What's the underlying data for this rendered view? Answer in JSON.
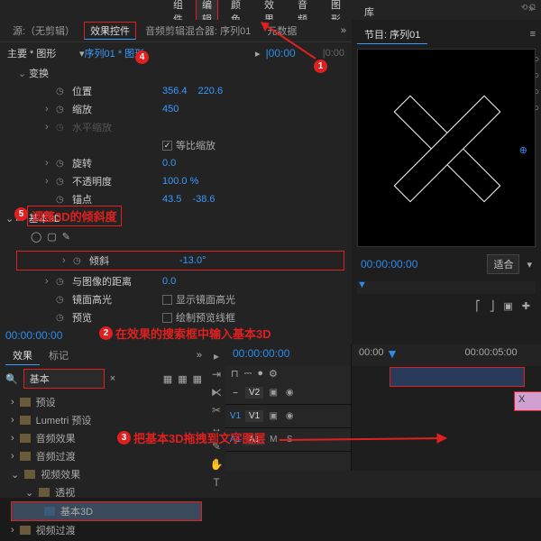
{
  "top_tabs": [
    "组件",
    "编辑",
    "颜色",
    "效果",
    "音频",
    "图形",
    "库"
  ],
  "active_top": 1,
  "source_label": "源:（无剪辑）",
  "panel_tabs": {
    "effect_controls": "效果控件",
    "audio_mixer": "音频剪辑混合器: 序列01",
    "metadata": "元数据"
  },
  "main_label": "主要 * 图形",
  "clip_label": "序列01 * 图形",
  "groups": {
    "transform": "变换",
    "rows": [
      {
        "n": "位置",
        "v": [
          "356.4",
          "220.6"
        ]
      },
      {
        "n": "缩放",
        "v": [
          "450"
        ]
      },
      {
        "n": "水平缩放",
        "dim": true
      },
      {
        "n": "等比缩放",
        "check": true
      },
      {
        "n": "旋转",
        "v": [
          "0.0"
        ]
      },
      {
        "n": "不透明度",
        "v": [
          "100.0 %"
        ]
      },
      {
        "n": "锚点",
        "v": [
          "43.5",
          "-38.6"
        ]
      }
    ]
  },
  "fx_name": "基本3D",
  "fx_rows": [
    {
      "n": "倾斜",
      "v": [
        "-13.0°"
      ],
      "box": true
    },
    {
      "n": "与图像的距离",
      "v": [
        "0.0"
      ]
    },
    {
      "n": "镜面高光",
      "chklabel": "显示镜面高光"
    },
    {
      "n": "预览",
      "chklabel": "绘制预览线框"
    }
  ],
  "anno5": "调整3D的倾斜度",
  "tc": "00:00:00:00",
  "effects_tabs": {
    "effects": "效果",
    "markers": "标记"
  },
  "search_val": "基本",
  "anno2": "在效果的搜索框中输入基本3D",
  "tree": [
    {
      "t": "预设",
      "f": 1
    },
    {
      "t": "Lumetri 预设",
      "f": 1
    },
    {
      "t": "音频效果",
      "f": 1
    },
    {
      "t": "音频过渡",
      "f": 1
    },
    {
      "t": "视频效果",
      "f": 1,
      "open": true
    },
    {
      "t": "透视",
      "f": 1,
      "open": true,
      "indent": 1
    },
    {
      "t": "基本3D",
      "f": 0,
      "indent": 2,
      "sel": true
    },
    {
      "t": "视频过渡",
      "f": 1
    }
  ],
  "anno3": "把基本3D拖拽到文字图层",
  "program_title": "节目: 序列01",
  "fit": "适合",
  "tl_tc": "00:00:00:00",
  "tl_marks": [
    "00:00",
    "00:00:05:00"
  ],
  "tracks": {
    "v2": "V2",
    "v1": "V1",
    "a1": "A1"
  },
  "clip_txt": "X"
}
